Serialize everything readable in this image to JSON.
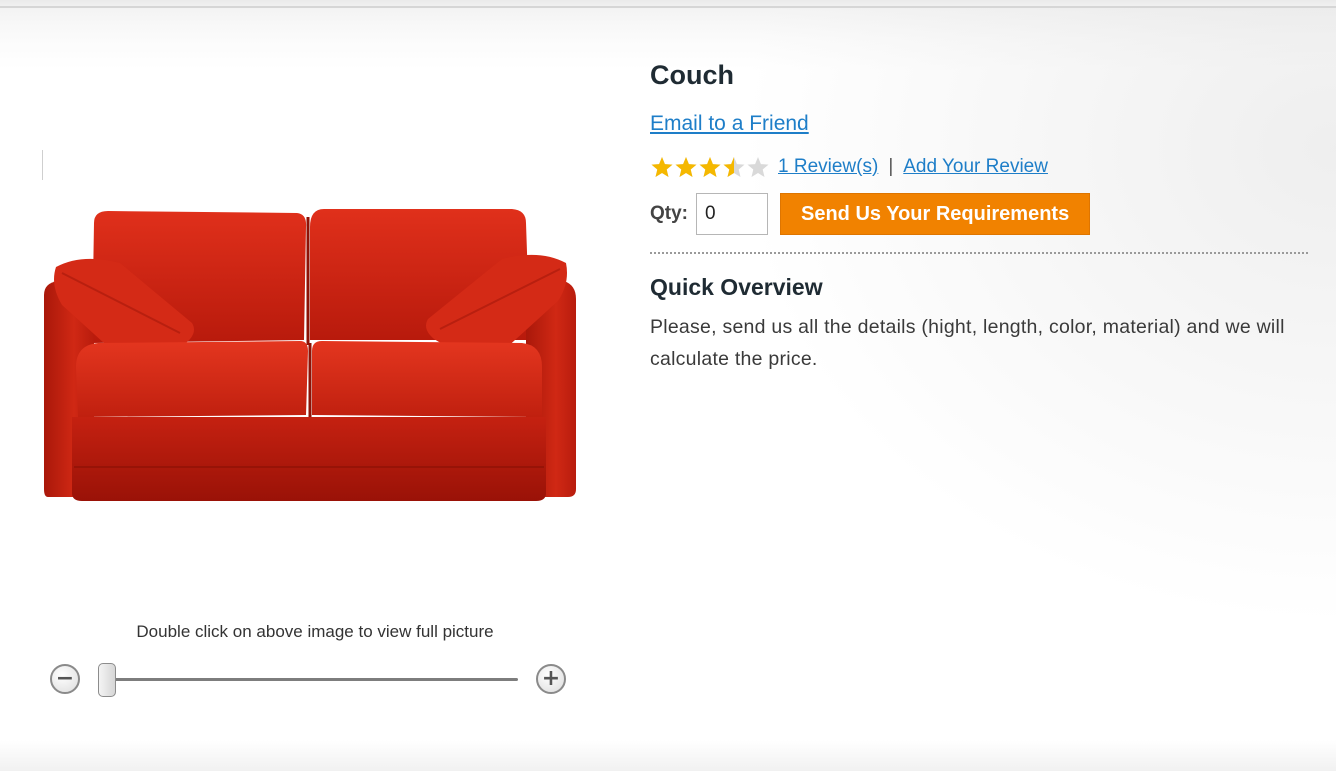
{
  "product": {
    "name": "Couch",
    "email_link": "Email to a Friend",
    "rating": {
      "stars": 3.5,
      "max": 5,
      "star_color": "#f5b800",
      "empty_color": "#d9d9d9"
    },
    "reviews_link": "1 Review(s)",
    "separator": "|",
    "add_review_link": "Add Your Review",
    "qty_label": "Qty:",
    "qty_value": "0",
    "send_button": "Send Us Your Requirements",
    "overview_title": "Quick Overview",
    "overview_text": "Please, send us all the details (hight, length, color, material) and we will calculate the price."
  },
  "image": {
    "zoom_hint": "Double click on above image to view full picture",
    "zoom_out_icon": "minus-icon",
    "zoom_in_icon": "plus-icon",
    "zoom_level": 0
  },
  "colors": {
    "accent_button": "#f18200",
    "link": "#1e7ec8",
    "sofa": "#c92312"
  }
}
